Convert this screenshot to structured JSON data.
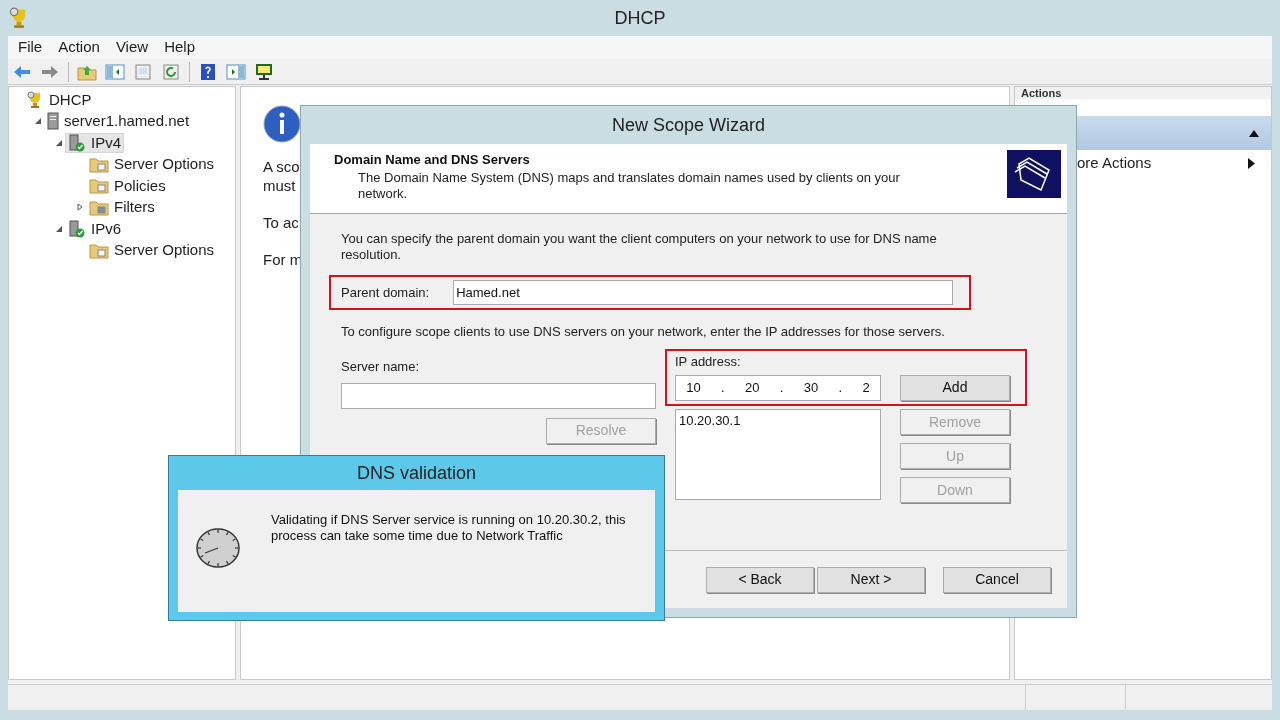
{
  "window": {
    "title": "DHCP"
  },
  "menu": [
    "File",
    "Action",
    "View",
    "Help"
  ],
  "tree": [
    {
      "label": "DHCP",
      "kind": "root",
      "selected": false,
      "children": [
        {
          "label": "server1.hamed.net",
          "kind": "server",
          "selected": false,
          "expanded": true,
          "children": [
            {
              "label": "IPv4",
              "kind": "protocol",
              "selected": true,
              "expanded": true,
              "children": [
                {
                  "label": "Server Options",
                  "kind": "options",
                  "selected": false
                },
                {
                  "label": "Policies",
                  "kind": "policies",
                  "selected": false
                },
                {
                  "label": "Filters",
                  "kind": "filters",
                  "selected": false,
                  "expanded": false
                }
              ]
            },
            {
              "label": "IPv6",
              "kind": "protocol",
              "selected": false,
              "expanded": true,
              "children": [
                {
                  "label": "Server Options",
                  "kind": "options",
                  "selected": false
                }
              ]
            }
          ]
        }
      ]
    }
  ],
  "middle_pane": {
    "lines": [
      [
        "A sco",
        "must"
      ],
      [
        "To ac"
      ],
      [
        "For m"
      ]
    ]
  },
  "actions_pane": {
    "title": "Actions",
    "items": [
      "ore Actions"
    ]
  },
  "wizard": {
    "title": "New Scope Wizard",
    "heading": "Domain Name and DNS Servers",
    "subheading": "The Domain Name System (DNS) maps and translates domain names used by clients on your network.",
    "intro": "You can specify the parent domain you want the client computers on your network to use for DNS name resolution.",
    "parent_domain": {
      "label": "Parent domain:",
      "value": "Hamed.net"
    },
    "dns_intro": "To configure scope clients to use DNS servers on your network, enter the IP addresses for those servers.",
    "server_name": {
      "label": "Server name:"
    },
    "ip_address": {
      "label": "IP address:",
      "octets": [
        "10",
        "20",
        "30",
        "2"
      ],
      "separator": "."
    },
    "resolve": {
      "label": "Resolve",
      "disabled": true
    },
    "ip_list": [
      "10.20.30.1"
    ],
    "side_buttons": [
      {
        "label": "Add",
        "disabled": false
      },
      {
        "label": "Remove",
        "disabled": true
      },
      {
        "label": "Up",
        "disabled": true
      },
      {
        "label": "Down",
        "disabled": true
      }
    ],
    "footer_buttons": [
      {
        "label": "< Back",
        "disabled": false
      },
      {
        "label": "Next >",
        "disabled": false
      },
      {
        "label": "Cancel",
        "disabled": false
      }
    ]
  },
  "dialog": {
    "title": "DNS validation",
    "message": "Validating if DNS Server service is running on 10.20.30.2, this process can take some time due to Network Traffic"
  }
}
